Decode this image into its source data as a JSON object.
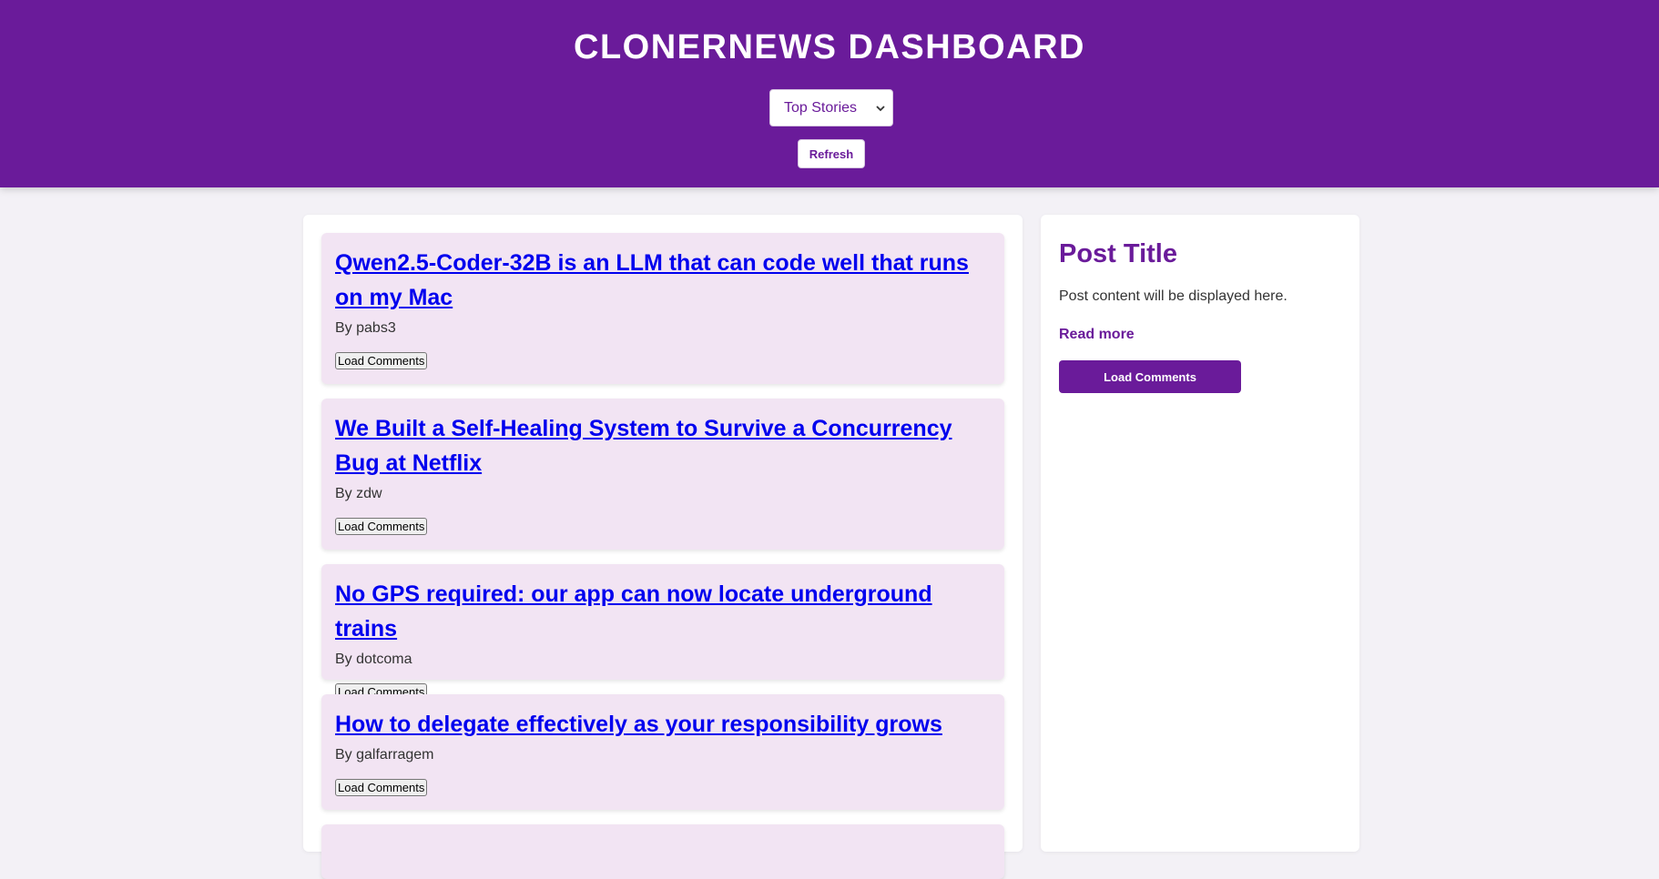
{
  "header": {
    "title": "CLONERNEWS DASHBOARD",
    "feed_select": {
      "selected": "Top Stories"
    },
    "refresh_label": "Refresh"
  },
  "stories": [
    {
      "title": "Qwen2.5-Coder-32B is an LLM that can code well that runs on my Mac",
      "author": "By pabs3",
      "button": "Load Comments"
    },
    {
      "title": "We Built a Self-Healing System to Survive a Concurrency Bug at Netflix",
      "author": "By zdw",
      "button": "Load Comments"
    },
    {
      "title": "No GPS required: our app can now locate underground trains",
      "author": "By dotcoma",
      "button": "Load Comments"
    },
    {
      "title": "How to delegate effectively as your responsibility grows",
      "author": "By galfarragem",
      "button": "Load Comments"
    }
  ],
  "sidebar": {
    "post_title": "Post Title",
    "post_content": "Post content will be displayed here.",
    "read_more": "Read more",
    "load_comments": "Load Comments"
  },
  "colors": {
    "brand": "#6a1b9a",
    "story_bg": "#f2e4f3",
    "link": "#0000ee",
    "page_bg": "#f3f1f6"
  },
  "icons": {
    "select_chevron": "chevron-down-icon"
  }
}
